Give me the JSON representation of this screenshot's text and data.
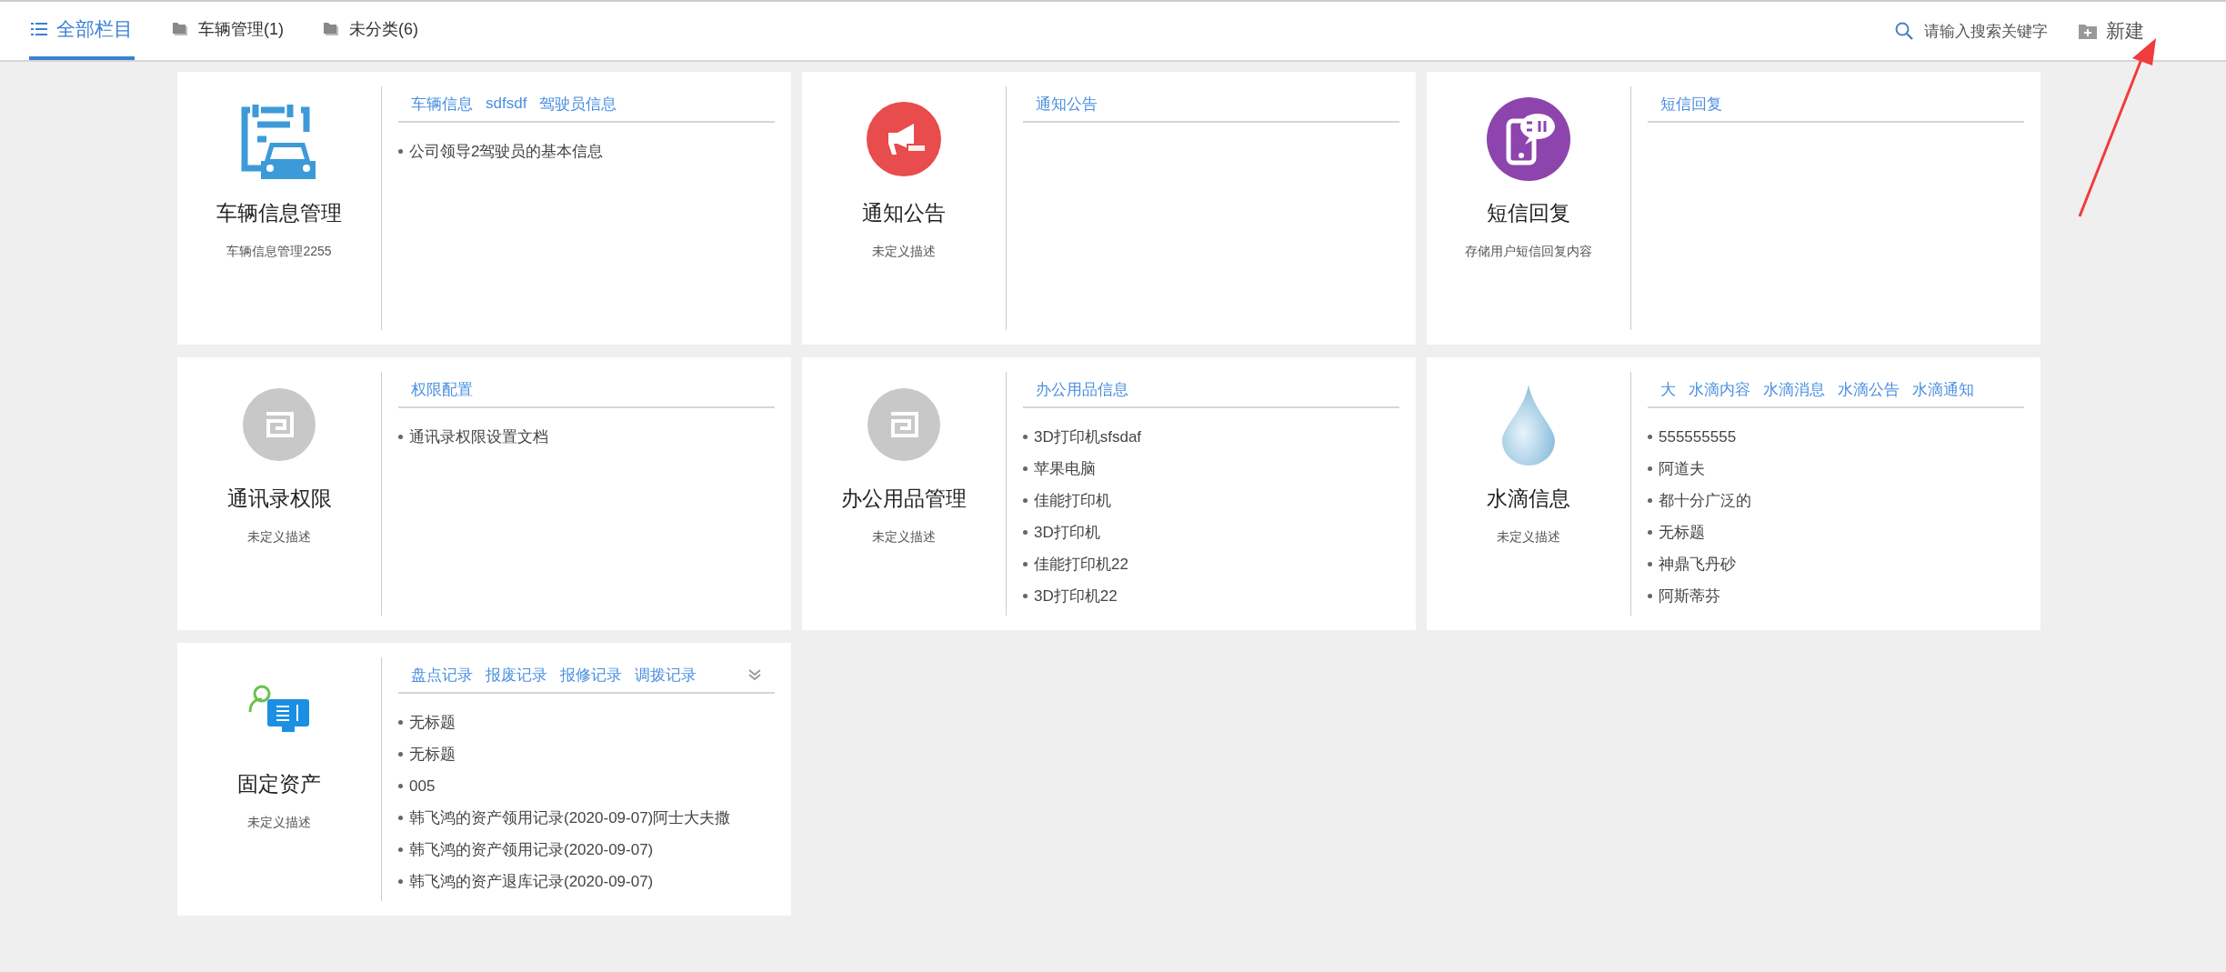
{
  "nav": {
    "tabs": [
      {
        "label": "全部栏目",
        "selected": true,
        "kind": "all"
      },
      {
        "label": "车辆管理(1)",
        "selected": false,
        "kind": "category"
      },
      {
        "label": "未分类(6)",
        "selected": false,
        "kind": "category"
      }
    ],
    "search": {
      "placeholder": "请输入搜索关键字"
    },
    "new_button": "新建"
  },
  "cards": [
    {
      "kind": "vehicle",
      "title": "车辆信息管理",
      "description": "车辆信息管理2255",
      "tabs": [
        "车辆信息",
        "sdfsdf",
        "驾驶员信息"
      ],
      "items": [
        "公司领导2驾驶员的基本信息"
      ]
    },
    {
      "kind": "notice",
      "title": "通知公告",
      "description": "未定义描述",
      "tabs": [
        "通知公告"
      ]
    },
    {
      "kind": "sms",
      "title": "短信回复",
      "description": "存储用户短信回复内容",
      "tabs": [
        "短信回复"
      ]
    },
    {
      "kind": "generic",
      "title": "通讯录权限",
      "description": "未定义描述",
      "tabs": [
        "权限配置"
      ],
      "items": [
        "通讯录权限设置文档"
      ]
    },
    {
      "kind": "generic",
      "title": "办公用品管理",
      "description": "未定义描述",
      "tabs": [
        "办公用品信息"
      ],
      "items": [
        "3D打印机sfsdaf",
        "苹果电脑",
        "佳能打印机",
        "3D打印机",
        "佳能打印机22",
        "3D打印机22"
      ]
    },
    {
      "kind": "drop",
      "title": "水滴信息",
      "description": "未定义描述",
      "tabs": [
        "大",
        "水滴内容",
        "水滴消息",
        "水滴公告",
        "水滴通知"
      ],
      "items": [
        "555555555",
        "阿道夫",
        "都十分广泛的",
        "无标题",
        "神鼎飞丹砂",
        "阿斯蒂芬"
      ]
    },
    {
      "kind": "asset",
      "title": "固定资产",
      "description": "未定义描述",
      "tabs": [
        "盘点记录",
        "报废记录",
        "报修记录",
        "调拨记录"
      ],
      "items": [
        "无标题",
        "无标题",
        "005",
        "韩飞鸿的资产领用记录(2020-09-07)阿士大夫撒",
        "韩飞鸿的资产领用记录(2020-09-07)",
        "韩飞鸿的资产退库记录(2020-09-07)"
      ],
      "has_more": true
    }
  ]
}
